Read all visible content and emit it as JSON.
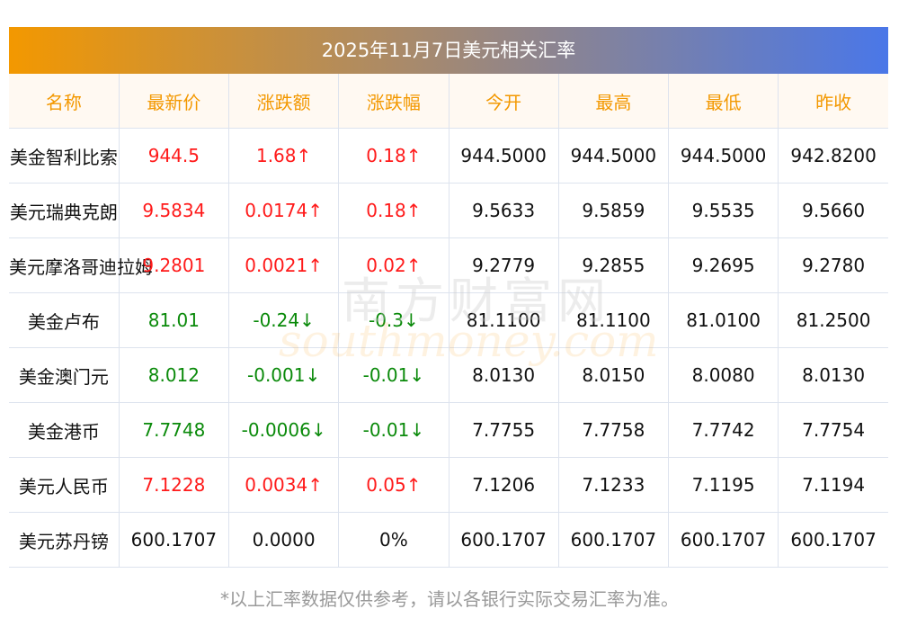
{
  "title": "2025年11月7日美元相关汇率",
  "headers": [
    "名称",
    "最新价",
    "涨跌额",
    "涨跌幅",
    "今开",
    "最高",
    "最低",
    "昨收"
  ],
  "rows": [
    {
      "name": "美金智利比索",
      "latest": "944.5",
      "change": "1.68↑",
      "pct": "0.18↑",
      "open": "944.5000",
      "high": "944.5000",
      "low": "944.5000",
      "prev": "942.8200",
      "dir": "up"
    },
    {
      "name": "美元瑞典克朗",
      "latest": "9.5834",
      "change": "0.0174↑",
      "pct": "0.18↑",
      "open": "9.5633",
      "high": "9.5859",
      "low": "9.5535",
      "prev": "9.5660",
      "dir": "up"
    },
    {
      "name": "美元摩洛哥迪拉姆",
      "latest": "9.2801",
      "change": "0.0021↑",
      "pct": "0.02↑",
      "open": "9.2779",
      "high": "9.2855",
      "low": "9.2695",
      "prev": "9.2780",
      "dir": "up"
    },
    {
      "name": "美金卢布",
      "latest": "81.01",
      "change": "-0.24↓",
      "pct": "-0.3↓",
      "open": "81.1100",
      "high": "81.1100",
      "low": "81.0100",
      "prev": "81.2500",
      "dir": "down"
    },
    {
      "name": "美金澳门元",
      "latest": "8.012",
      "change": "-0.001↓",
      "pct": "-0.01↓",
      "open": "8.0130",
      "high": "8.0150",
      "low": "8.0080",
      "prev": "8.0130",
      "dir": "down"
    },
    {
      "name": "美金港币",
      "latest": "7.7748",
      "change": "-0.0006↓",
      "pct": "-0.01↓",
      "open": "7.7755",
      "high": "7.7758",
      "low": "7.7742",
      "prev": "7.7754",
      "dir": "down"
    },
    {
      "name": "美元人民币",
      "latest": "7.1228",
      "change": "0.0034↑",
      "pct": "0.05↑",
      "open": "7.1206",
      "high": "7.1233",
      "low": "7.1195",
      "prev": "7.1194",
      "dir": "up"
    },
    {
      "name": "美元苏丹镑",
      "latest": "600.1707",
      "change": "0.0000",
      "pct": "0%",
      "open": "600.1707",
      "high": "600.1707",
      "low": "600.1707",
      "prev": "600.1707",
      "dir": "flat"
    }
  ],
  "watermark": {
    "cn": "南方财富网",
    "en": "southmoney.com"
  },
  "note": "*以上汇率数据仅供参考，请以各银行实际交易汇率为准。",
  "colors": {
    "up": "#ff1a1a",
    "down": "#0a8a0a",
    "header": "#f39800"
  }
}
